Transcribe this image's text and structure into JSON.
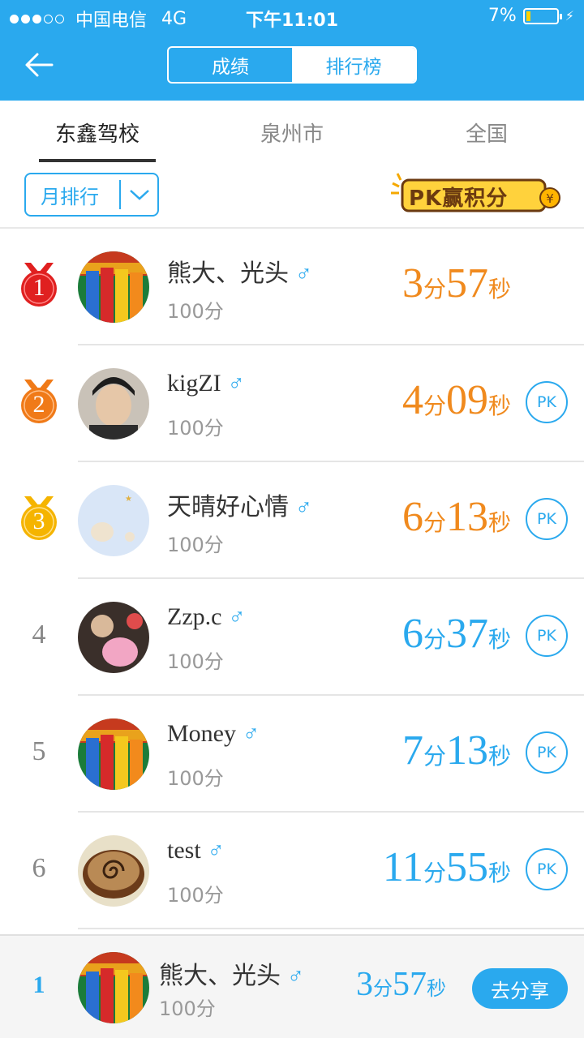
{
  "status_bar": {
    "carrier": "中国电信",
    "network": "4G",
    "time": "下午11:01",
    "battery": "7%"
  },
  "header": {
    "segments": [
      "成绩",
      "排行榜"
    ],
    "active_segment": 1
  },
  "tabs": [
    {
      "label": "东鑫驾校",
      "active": true
    },
    {
      "label": "泉州市",
      "active": false
    },
    {
      "label": "全国",
      "active": false
    }
  ],
  "filter": {
    "label": "月排行"
  },
  "promo": {
    "label": "PK赢积分"
  },
  "ranking": [
    {
      "rank": "1",
      "name": "熊大、光头",
      "score": "100分",
      "min": "3",
      "min_unit": "分",
      "sec": "57",
      "sec_unit": "秒",
      "pk": ""
    },
    {
      "rank": "2",
      "name": "kigZI",
      "score": "100分",
      "min": "4",
      "min_unit": "分",
      "sec": "09",
      "sec_unit": "秒",
      "pk": "PK"
    },
    {
      "rank": "3",
      "name": "天晴好心情",
      "score": "100分",
      "min": "6",
      "min_unit": "分",
      "sec": "13",
      "sec_unit": "秒",
      "pk": "PK"
    },
    {
      "rank": "4",
      "name": "Zzp.c",
      "score": "100分",
      "min": "6",
      "min_unit": "分",
      "sec": "37",
      "sec_unit": "秒",
      "pk": "PK"
    },
    {
      "rank": "5",
      "name": "Money",
      "score": "100分",
      "min": "7",
      "min_unit": "分",
      "sec": "13",
      "sec_unit": "秒",
      "pk": "PK"
    },
    {
      "rank": "6",
      "name": "test",
      "score": "100分",
      "min": "11",
      "min_unit": "分",
      "sec": "55",
      "sec_unit": "秒",
      "pk": "PK"
    }
  ],
  "gender_symbol": "♂",
  "me": {
    "rank": "1",
    "name": "熊大、光头",
    "score": "100分",
    "min": "3",
    "min_unit": "分",
    "sec": "57",
    "sec_unit": "秒",
    "share_label": "去分享"
  },
  "colors": {
    "accent": "#2aa9ee",
    "top3_time": "#f08a1e",
    "gold": "#f5b400",
    "silver": "#f07a18",
    "red_medal": "#e02020"
  }
}
